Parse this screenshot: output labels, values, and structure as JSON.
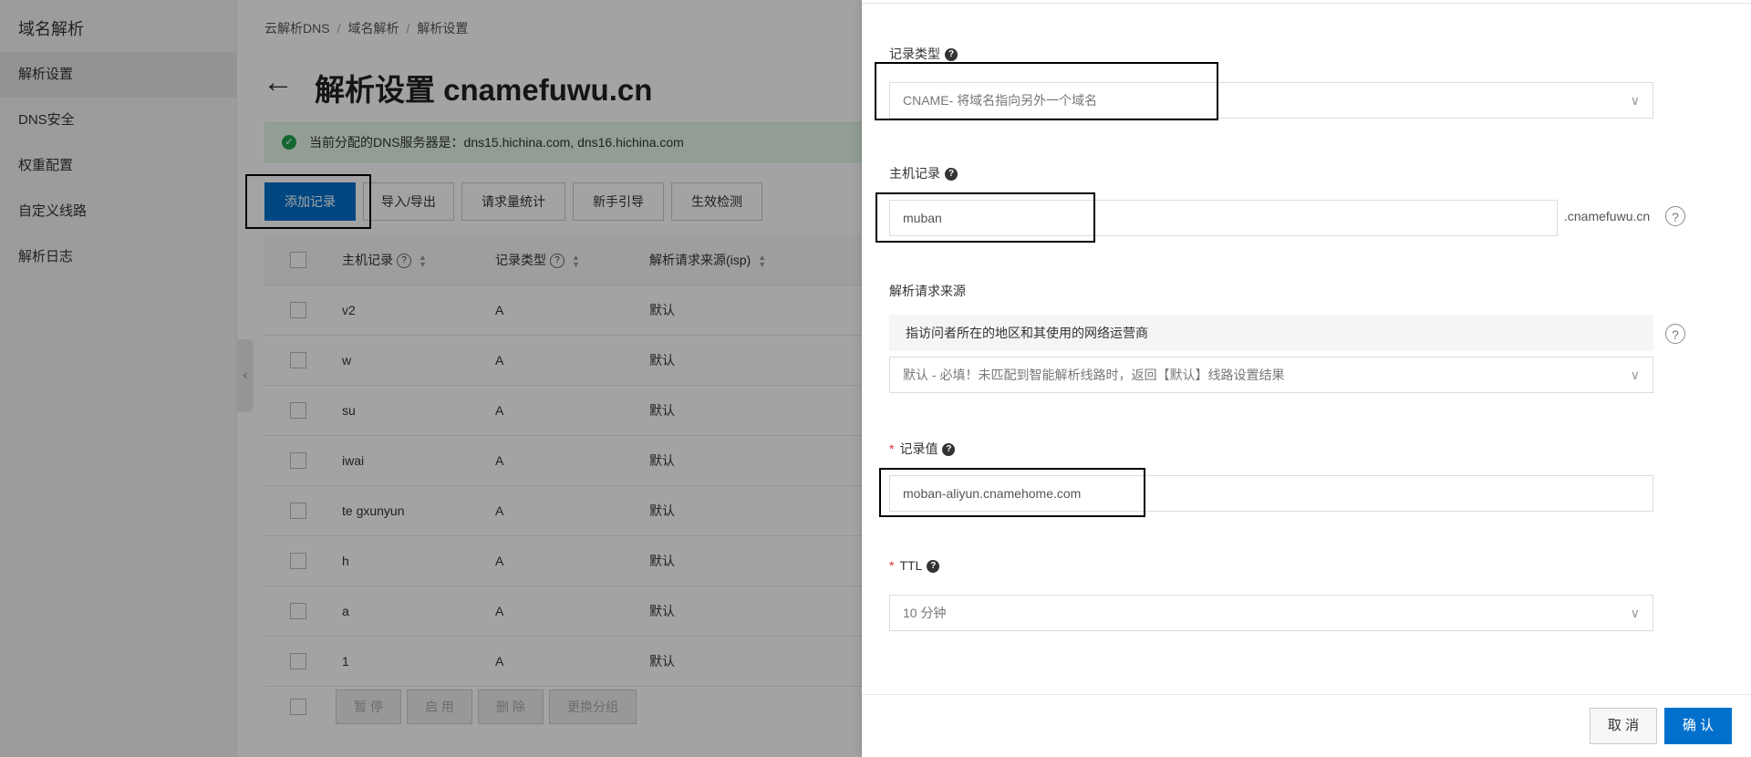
{
  "sidebar": {
    "title": "域名解析",
    "items": [
      {
        "label": "解析设置",
        "active": true
      },
      {
        "label": "DNS安全",
        "active": false
      },
      {
        "label": "权重配置",
        "active": false
      },
      {
        "label": "自定义线路",
        "active": false
      },
      {
        "label": "解析日志",
        "active": false
      }
    ]
  },
  "breadcrumb": [
    "云解析DNS",
    "域名解析",
    "解析设置"
  ],
  "page": {
    "title": "解析设置 cnamefuwu.cn",
    "dns_info": "当前分配的DNS服务器是：dns15.hichina.com, dns16.hichina.com"
  },
  "toolbar": {
    "add": "添加记录",
    "import_export": "导入/导出",
    "stats": "请求量统计",
    "guide": "新手引导",
    "check": "生效检测"
  },
  "table": {
    "headers": {
      "host": "主机记录",
      "type": "记录类型",
      "line": "解析请求来源(isp)"
    },
    "rows": [
      {
        "host": "v2",
        "type": "A",
        "line": "默认"
      },
      {
        "host": "w",
        "type": "A",
        "line": "默认"
      },
      {
        "host": "su",
        "type": "A",
        "line": "默认"
      },
      {
        "host": "iwai",
        "type": "A",
        "line": "默认"
      },
      {
        "host": "te gxunyun",
        "type": "A",
        "line": "默认"
      },
      {
        "host": "h",
        "type": "A",
        "line": "默认"
      },
      {
        "host": "a",
        "type": "A",
        "line": "默认"
      },
      {
        "host": "1",
        "type": "A",
        "line": "默认"
      }
    ],
    "batch": {
      "pause": "暂 停",
      "enable": "启 用",
      "delete": "删 除",
      "group": "更换分组"
    }
  },
  "drawer": {
    "record_type_label": "记录类型",
    "record_type_value": "CNAME- 将域名指向另外一个域名",
    "host_label": "主机记录",
    "host_value": "muban",
    "host_suffix": ".cnamefuwu.cn",
    "line_label": "解析请求来源",
    "line_hint": "指访问者所在的地区和其使用的网络运营商",
    "line_value": "默认 - 必填！未匹配到智能解析线路时，返回【默认】线路设置结果",
    "value_label": "记录值",
    "value_value": "moban-aliyun.cnamehome.com",
    "ttl_label": "TTL",
    "ttl_value": "10 分钟",
    "cancel": "取 消",
    "confirm": "确 认"
  },
  "colors": {
    "primary": "#0070cc",
    "success_bg": "#e4f7e7",
    "required": "#e0302d",
    "highlight": "#000000"
  }
}
